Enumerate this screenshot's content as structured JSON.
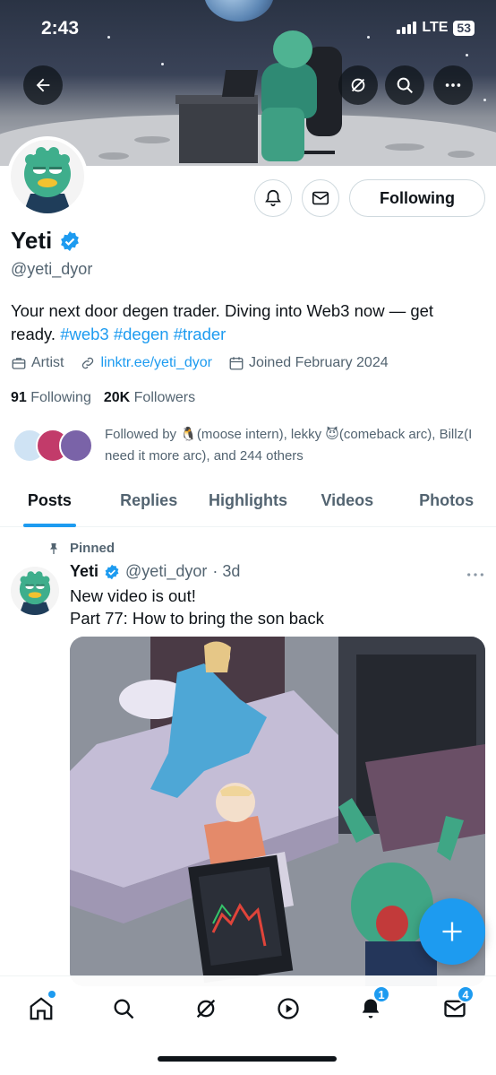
{
  "status_bar": {
    "time": "2:43",
    "network": "LTE",
    "battery": "53"
  },
  "profile": {
    "name": "Yeti",
    "handle": "@yeti_dyor",
    "bio_text": "Your next door degen trader. Diving into Web3 now — get ready.",
    "hashtags": [
      "#web3",
      "#degen",
      "#trader"
    ],
    "category": "Artist",
    "link": "linktr.ee/yeti_dyor",
    "joined": "Joined February 2024",
    "following_count": "91",
    "following_label": "Following",
    "followers_count": "20K",
    "followers_label": "Followers",
    "followed_by": "Followed by 🐧(moose intern), lekky 😈(comeback arc), Billz(I need it more arc), and 244 others",
    "follow_button_label": "Following"
  },
  "tabs": [
    "Posts",
    "Replies",
    "Highlights",
    "Videos",
    "Photos"
  ],
  "active_tab": "Posts",
  "pinned_post": {
    "pinned_label": "Pinned",
    "author_name": "Yeti",
    "author_handle": "@yeti_dyor",
    "time": "· 3d",
    "line1": "New video is out!",
    "line2": "Part 77: How to bring the son back"
  },
  "bottom_nav": {
    "items": [
      "home-icon",
      "search-icon",
      "grok-icon",
      "video-icon",
      "notifications-icon",
      "messages-icon"
    ],
    "notifications_badge": "1",
    "messages_badge": "4"
  },
  "colors": {
    "accent": "#1d9bf0",
    "text": "#0f1419",
    "secondary": "#536471"
  }
}
